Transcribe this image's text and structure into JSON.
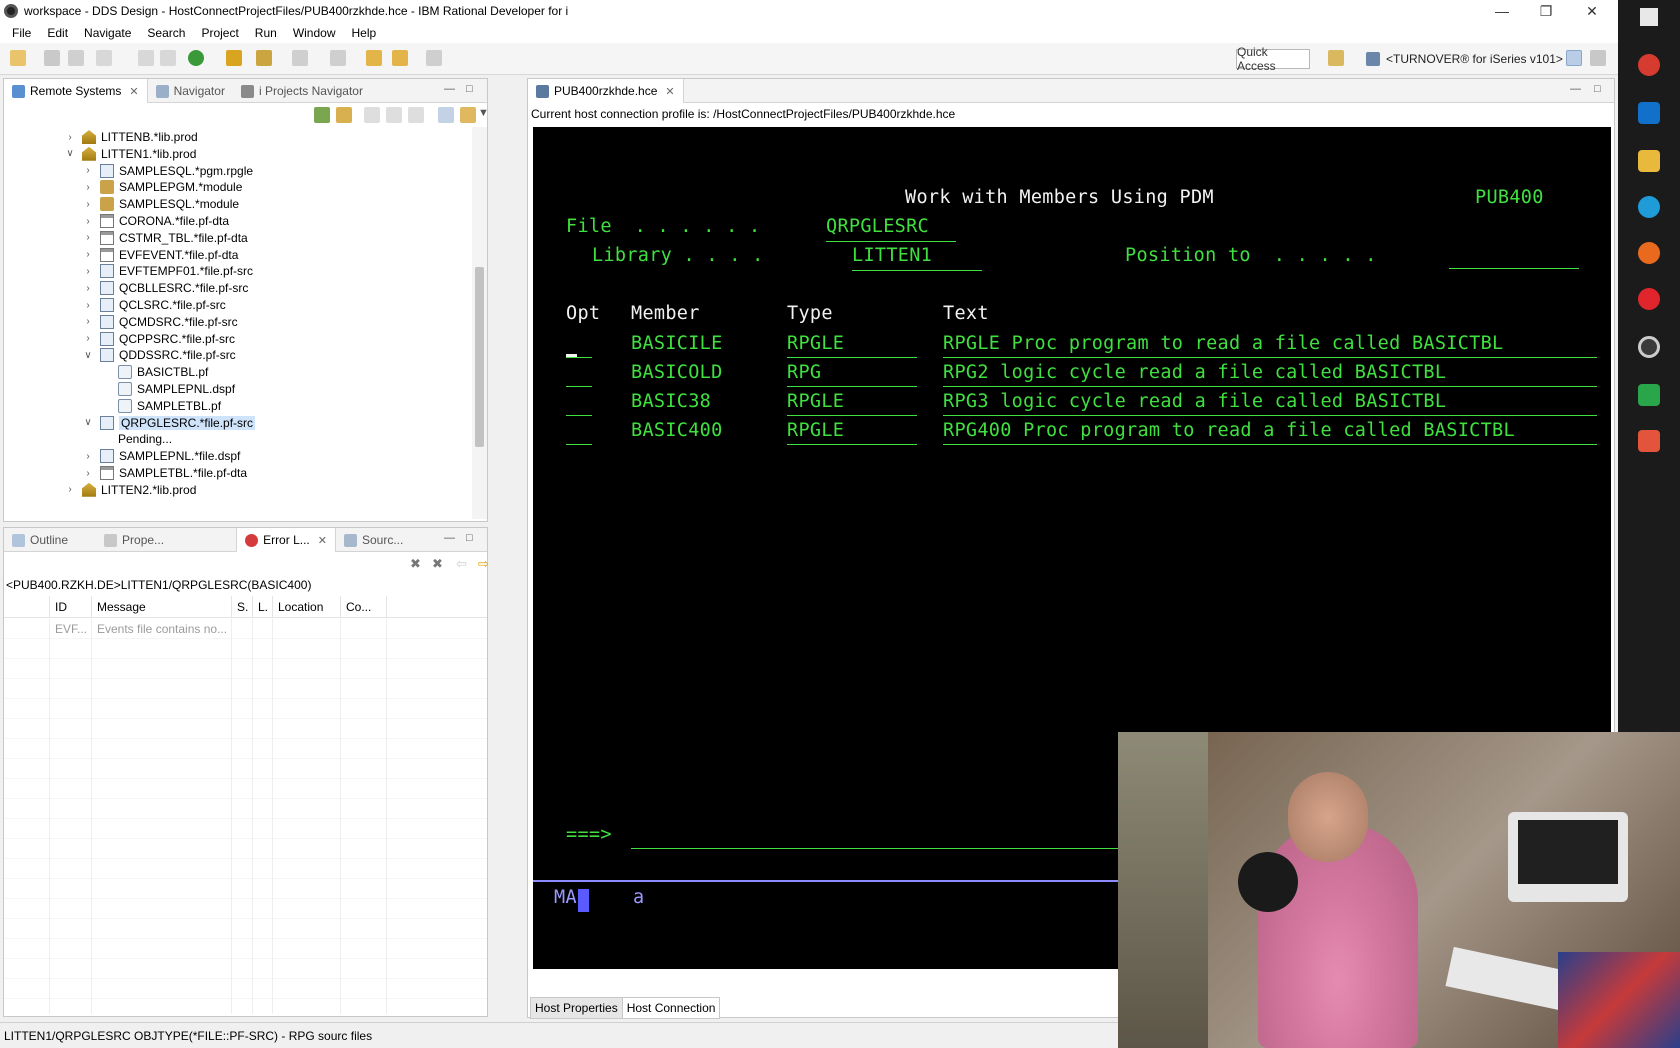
{
  "window": {
    "title": "workspace - DDS Design - HostConnectProjectFiles/PUB400rzkhde.hce - IBM Rational Developer for i"
  },
  "menu": [
    "File",
    "Edit",
    "Navigate",
    "Search",
    "Project",
    "Run",
    "Window",
    "Help"
  ],
  "toolbar": {
    "quick_access": "Quick Access",
    "perspective": "<TURNOVER® for iSeries v101>"
  },
  "left_top": {
    "tabs": [
      "Remote Systems",
      "Navigator",
      "i Projects Navigator"
    ],
    "tree": [
      {
        "label": "LITTENB.*lib.prod",
        "level": 0,
        "expand": "closed",
        "icon": "library-icon"
      },
      {
        "label": "LITTEN1.*lib.prod",
        "level": 0,
        "expand": "open",
        "icon": "library-icon"
      },
      {
        "label": "SAMPLESQL.*pgm.rpgle",
        "level": 1,
        "expand": "closed",
        "icon": "program-icon"
      },
      {
        "label": "SAMPLEPGM.*module",
        "level": 1,
        "expand": "closed",
        "icon": "module-icon"
      },
      {
        "label": "SAMPLESQL.*module",
        "level": 1,
        "expand": "closed",
        "icon": "module-icon"
      },
      {
        "label": "CORONA.*file.pf-dta",
        "level": 1,
        "expand": "closed",
        "icon": "file-icon"
      },
      {
        "label": "CSTMR_TBL.*file.pf-dta",
        "level": 1,
        "expand": "closed",
        "icon": "file-icon"
      },
      {
        "label": "EVFEVENT.*file.pf-dta",
        "level": 1,
        "expand": "closed",
        "icon": "file-icon"
      },
      {
        "label": "EVFTEMPF01.*file.pf-src",
        "level": 1,
        "expand": "closed",
        "icon": "source-file-icon"
      },
      {
        "label": "QCBLLESRC.*file.pf-src",
        "level": 1,
        "expand": "closed",
        "icon": "source-file-icon"
      },
      {
        "label": "QCLSRC.*file.pf-src",
        "level": 1,
        "expand": "closed",
        "icon": "source-file-icon"
      },
      {
        "label": "QCMDSRC.*file.pf-src",
        "level": 1,
        "expand": "closed",
        "icon": "source-file-icon"
      },
      {
        "label": "QCPPSRC.*file.pf-src",
        "level": 1,
        "expand": "closed",
        "icon": "source-file-icon"
      },
      {
        "label": "QDDSSRC.*file.pf-src",
        "level": 1,
        "expand": "open",
        "icon": "source-file-icon"
      },
      {
        "label": "BASICTBL.pf",
        "level": 2,
        "expand": "none",
        "icon": "member-icon"
      },
      {
        "label": "SAMPLEPNL.dspf",
        "level": 2,
        "expand": "none",
        "icon": "member-icon"
      },
      {
        "label": "SAMPLETBL.pf",
        "level": 2,
        "expand": "none",
        "icon": "member-icon"
      },
      {
        "label": "QRPGLESRC.*file.pf-src",
        "level": 1,
        "expand": "open",
        "icon": "source-file-icon",
        "selected": true
      },
      {
        "label": "Pending...",
        "level": 2,
        "expand": "none",
        "icon": "none"
      },
      {
        "label": "SAMPLEPNL.*file.dspf",
        "level": 1,
        "expand": "closed",
        "icon": "display-file-icon"
      },
      {
        "label": "SAMPLETBL.*file.pf-dta",
        "level": 1,
        "expand": "closed",
        "icon": "file-icon"
      },
      {
        "label": "LITTEN2.*lib.prod",
        "level": 0,
        "expand": "closed",
        "icon": "library-icon"
      }
    ]
  },
  "left_bottom": {
    "tabs": [
      "Outline",
      "Prope...",
      "Error L...",
      "Sourc..."
    ],
    "path": "<PUB400.RZKH.DE>LITTEN1/QRPGLESRC(BASIC400)",
    "columns": [
      "ID",
      "Message",
      "S.",
      "L.",
      "Location",
      "Co..."
    ],
    "rows": [
      [
        "EVF...",
        "Events file contains no...",
        "",
        "",
        "",
        ""
      ]
    ]
  },
  "editor": {
    "tab": "PUB400rzkhde.hce",
    "profile": "Current host connection profile is: /HostConnectProjectFiles/PUB400rzkhde.hce",
    "bottom_tabs": [
      "Host Properties",
      "Host Connection"
    ]
  },
  "terminal": {
    "title": "Work with Members Using PDM",
    "system": "PUB400",
    "file_label": "File  . . . . . .",
    "file_value": "QRPGLESRC",
    "library_label": "Library . . . .",
    "library_value": "LITTEN1",
    "position_label": "Position to  . . . . .",
    "headers": {
      "opt": "Opt",
      "member": "Member",
      "type": "Type",
      "text": "Text"
    },
    "rows": [
      {
        "member": "BASICILE",
        "type": "RPGLE",
        "text": "RPGLE Proc program to read a file called BASICTBL"
      },
      {
        "member": "BASICOLD",
        "type": "RPG",
        "text": "RPG2 logic cycle read a file called BASICTBL"
      },
      {
        "member": "BASIC38",
        "type": "RPGLE",
        "text": "RPG3 logic cycle read a file called BASICTBL"
      },
      {
        "member": "BASIC400",
        "type": "RPGLE",
        "text": "RPG400 Proc program to read a file called BASICTBL"
      }
    ],
    "prompt": "===>",
    "oia_left": "MA",
    "oia_mid": "a"
  },
  "status_bar": "LITTEN1/QRPGLESRC OBJTYPE(*FILE::PF-SRC) - RPG sourc files",
  "colors": {
    "terminal_green": "#3fe03f",
    "terminal_bg": "#000000",
    "selection": "#cfe3fb"
  }
}
